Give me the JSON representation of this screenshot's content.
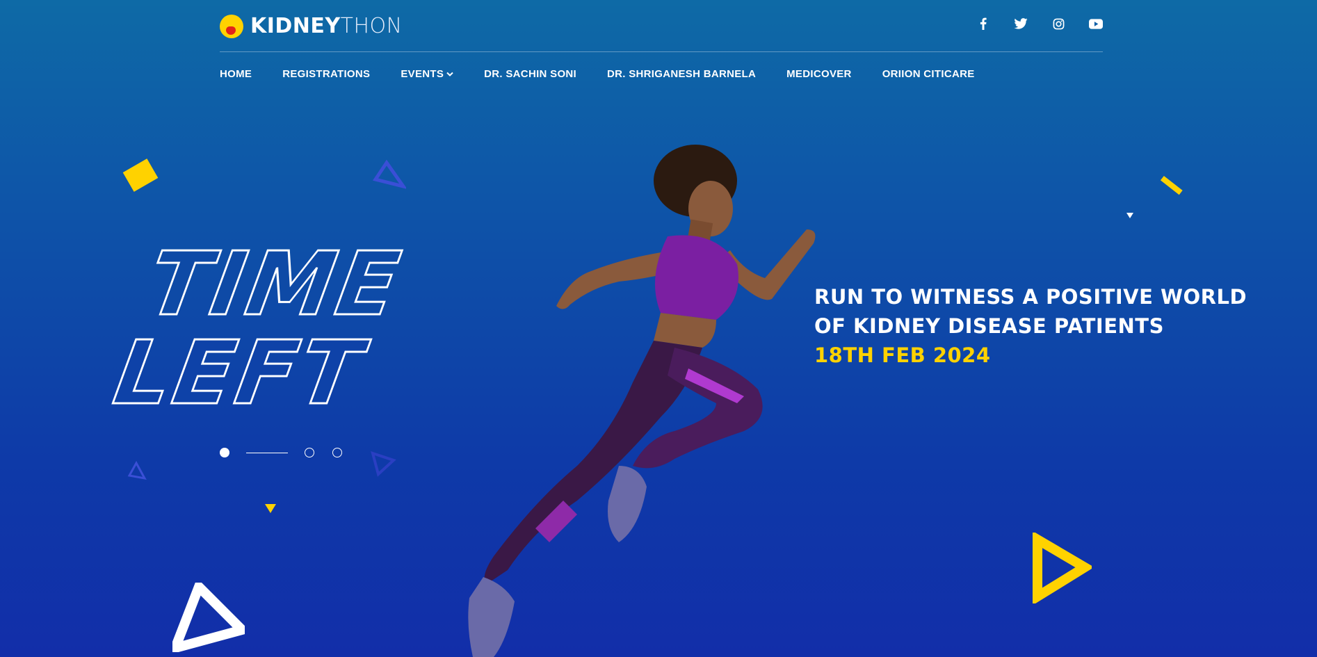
{
  "brand": {
    "name_strong": "KIDNEY",
    "name_light": "THON"
  },
  "socials": [
    {
      "name": "facebook-icon"
    },
    {
      "name": "twitter-icon"
    },
    {
      "name": "instagram-icon"
    },
    {
      "name": "youtube-icon"
    }
  ],
  "nav": {
    "home": "HOME",
    "registrations": "REGISTRATIONS",
    "events": "EVENTS",
    "dr_sachin": "DR. SACHIN SONI",
    "dr_shriganesh": "DR. SHRIGANESH BARNELA",
    "medicover": "MEDICOVER",
    "oriion": "ORIION CITICARE"
  },
  "hero": {
    "title_line1": "TIME",
    "title_line2": "LEFT",
    "tagline_line1": "RUN TO WITNESS A POSITIVE WORLD",
    "tagline_line2": "OF KIDNEY DISEASE PATIENTS",
    "date": "18TH FEB 2024"
  },
  "slider": {
    "active_index": 0,
    "count": 3
  },
  "colors": {
    "accent_yellow": "#ffd200",
    "background_top": "#0e6aa6",
    "background_bottom": "#122ea9",
    "runner_top": "#7b1fa2"
  }
}
